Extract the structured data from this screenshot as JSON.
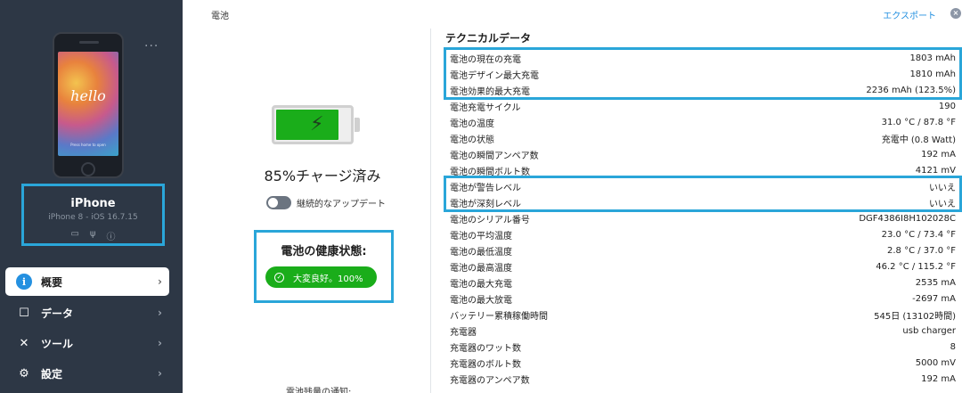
{
  "sidebar": {
    "device_name": "iPhone",
    "device_model": "iPhone 8 - iOS 16.7.15",
    "phone_screen_text": "hello",
    "phone_screen_hint": "Press home to open",
    "more_label": "...",
    "nav": [
      {
        "label": "概要",
        "active": true
      },
      {
        "label": "データ",
        "active": false
      },
      {
        "label": "ツール",
        "active": false
      },
      {
        "label": "設定",
        "active": false
      }
    ]
  },
  "header": {
    "title": "電池",
    "export_label": "エクスポート",
    "close_label": "×"
  },
  "battery": {
    "percent": 85,
    "status_text": "85%チャージ済み",
    "toggle_label": "継続的なアップデート",
    "health_title": "電池の健康状態:",
    "health_value": "大変良好。100%",
    "bottom_text": "電池残量の通知:"
  },
  "tech": {
    "title": "テクニカルデータ",
    "rows": [
      {
        "label": "電池の現在の充電",
        "value": "1803 mAh"
      },
      {
        "label": "電池デザイン最大充電",
        "value": "1810 mAh"
      },
      {
        "label": "電池効果的最大充電",
        "value": "2236 mAh (123.5%)"
      },
      {
        "label": "電池充電サイクル",
        "value": "190"
      },
      {
        "label": "電池の温度",
        "value": "31.0 °C / 87.8 °F"
      },
      {
        "label": "電池の状態",
        "value": "充電中 (0.8 Watt)"
      },
      {
        "label": "電池の瞬間アンペア数",
        "value": "192 mA"
      },
      {
        "label": "電池の瞬間ボルト数",
        "value": "4121 mV"
      },
      {
        "label": "電池が警告レベル",
        "value": "いいえ"
      },
      {
        "label": "電池が深刻レベル",
        "value": "いいえ"
      },
      {
        "label": "電池のシリアル番号",
        "value": "DGF4386I8H102028C"
      },
      {
        "label": "電池の平均温度",
        "value": "23.0 °C / 73.4 °F"
      },
      {
        "label": "電池の最低温度",
        "value": "2.8 °C / 37.0 °F"
      },
      {
        "label": "電池の最高温度",
        "value": "46.2 °C / 115.2 °F"
      },
      {
        "label": "電池の最大充電",
        "value": "2535 mA"
      },
      {
        "label": "電池の最大放電",
        "value": "-2697 mA"
      },
      {
        "label": "バッテリー累積稼働時間",
        "value": "545日 (13102時間)"
      },
      {
        "label": "充電器",
        "value": "usb charger"
      },
      {
        "label": "充電器のワット数",
        "value": "8"
      },
      {
        "label": "充電器のボルト数",
        "value": "5000 mV"
      },
      {
        "label": "充電器のアンペア数",
        "value": "192 mA"
      }
    ]
  },
  "colors": {
    "sidebar_bg": "#2d3745",
    "highlight": "#2aa6d9",
    "battery_green": "#1aad1a",
    "accent_blue": "#2490e0"
  }
}
